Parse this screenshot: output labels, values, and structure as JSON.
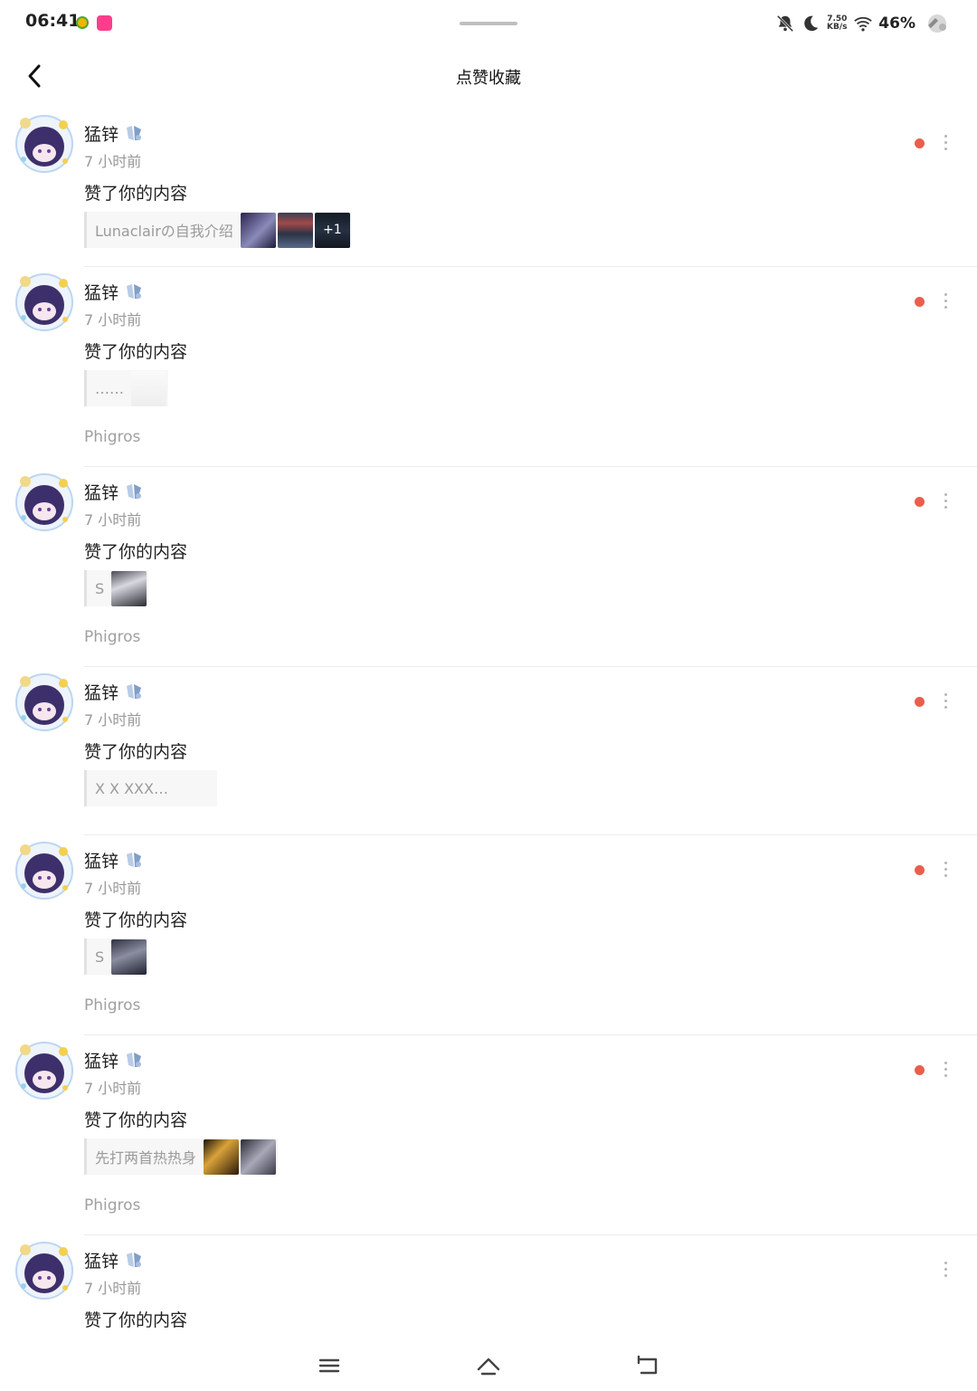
{
  "status_bar": {
    "time": "06:41",
    "net_speed_value": "7.50",
    "net_speed_unit": "KB/s",
    "battery": "46%",
    "icons": [
      "app-icon",
      "app-icon",
      "bell-off-icon",
      "moon-icon",
      "wifi-icon",
      "battery-icon"
    ]
  },
  "header": {
    "title": "点赞收藏",
    "back_icon": "chevron-left-icon"
  },
  "colors": {
    "unread_dot": "#e8604c",
    "secondary_text": "#999999"
  },
  "notifications": [
    {
      "user": "猛锌",
      "time": "7 小时前",
      "action": "赞了你的内容",
      "quote": "Lunaclairの自我介绍",
      "thumb_count": 3,
      "more_label": "+1",
      "source": "",
      "unread": true
    },
    {
      "user": "猛锌",
      "time": "7 小时前",
      "action": "赞了你的内容",
      "quote": "……",
      "thumb_count": 1,
      "more_label": "",
      "source": "Phigros",
      "unread": true
    },
    {
      "user": "猛锌",
      "time": "7 小时前",
      "action": "赞了你的内容",
      "quote": "S",
      "thumb_count": 1,
      "more_label": "",
      "source": "Phigros",
      "unread": true
    },
    {
      "user": "猛锌",
      "time": "7 小时前",
      "action": "赞了你的内容",
      "quote": "X X XXX…",
      "thumb_count": 0,
      "more_label": "",
      "source": "",
      "unread": true
    },
    {
      "user": "猛锌",
      "time": "7 小时前",
      "action": "赞了你的内容",
      "quote": "S",
      "thumb_count": 1,
      "more_label": "",
      "source": "Phigros",
      "unread": true
    },
    {
      "user": "猛锌",
      "time": "7 小时前",
      "action": "赞了你的内容",
      "quote": "先打两首热热身",
      "thumb_count": 2,
      "more_label": "",
      "source": "Phigros",
      "unread": true
    },
    {
      "user": "猛锌",
      "time": "7 小时前",
      "action": "赞了你的内容",
      "quote": "",
      "thumb_count": 0,
      "more_label": "",
      "source": "",
      "unread": false
    }
  ],
  "nav_bar": {
    "icons": [
      "menu-icon",
      "home-icon",
      "back-icon"
    ]
  }
}
